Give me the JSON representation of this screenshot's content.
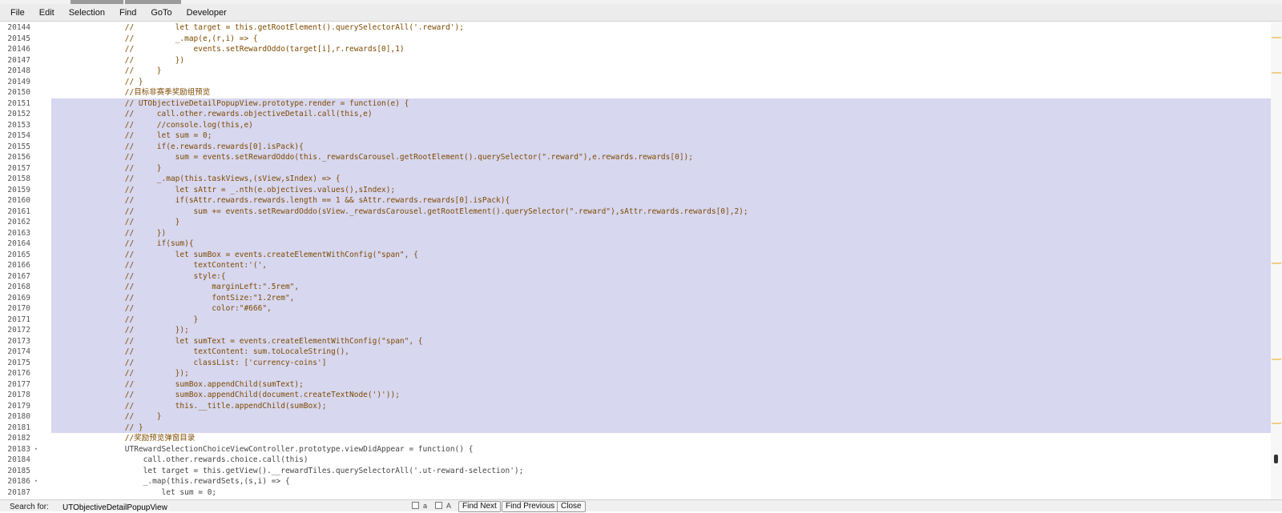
{
  "menu": [
    "File",
    "Edit",
    "Selection",
    "Find",
    "GoTo",
    "Developer"
  ],
  "colors": {
    "selection": "#d7d7f0",
    "comment": "#7d4a00",
    "line_number": "#555555",
    "scroll_marker": "#f1cf86"
  },
  "lines": [
    {
      "n": "20144",
      "code": "        //         let target = this.getRootElement().querySelectorAll('.reward');",
      "comment": true,
      "selected": false,
      "fold": false
    },
    {
      "n": "20145",
      "code": "        //         _.map(e,(r,i) => {",
      "comment": true,
      "selected": false,
      "fold": false
    },
    {
      "n": "20146",
      "code": "        //             events.setRewardOddo(target[i],r.rewards[0],1)",
      "comment": true,
      "selected": false,
      "fold": false
    },
    {
      "n": "20147",
      "code": "        //         })",
      "comment": true,
      "selected": false,
      "fold": false
    },
    {
      "n": "20148",
      "code": "        //     }",
      "comment": true,
      "selected": false,
      "fold": false
    },
    {
      "n": "20149",
      "code": "        // }",
      "comment": true,
      "selected": false,
      "fold": false
    },
    {
      "n": "20150",
      "code": "        //目标非赛季奖励组预览",
      "comment": true,
      "selected": false,
      "fold": false
    },
    {
      "n": "20151",
      "code": "        // UTObjectiveDetailPopupView.prototype.render = function(e) {",
      "comment": true,
      "selected": true,
      "fold": false
    },
    {
      "n": "20152",
      "code": "        //     call.other.rewards.objectiveDetail.call(this,e)",
      "comment": true,
      "selected": true,
      "fold": false
    },
    {
      "n": "20153",
      "code": "        //     //console.log(this,e)",
      "comment": true,
      "selected": true,
      "fold": false
    },
    {
      "n": "20154",
      "code": "        //     let sum = 0;",
      "comment": true,
      "selected": true,
      "fold": false
    },
    {
      "n": "20155",
      "code": "        //     if(e.rewards.rewards[0].isPack){",
      "comment": true,
      "selected": true,
      "fold": false
    },
    {
      "n": "20156",
      "code": "        //         sum = events.setRewardOddo(this._rewardsCarousel.getRootElement().querySelector(\".reward\"),e.rewards.rewards[0]);",
      "comment": true,
      "selected": true,
      "fold": false
    },
    {
      "n": "20157",
      "code": "        //     }",
      "comment": true,
      "selected": true,
      "fold": false
    },
    {
      "n": "20158",
      "code": "        //     _.map(this.taskViews,(sView,sIndex) => {",
      "comment": true,
      "selected": true,
      "fold": false
    },
    {
      "n": "20159",
      "code": "        //         let sAttr = _.nth(e.objectives.values(),sIndex);",
      "comment": true,
      "selected": true,
      "fold": false
    },
    {
      "n": "20160",
      "code": "        //         if(sAttr.rewards.rewards.length == 1 && sAttr.rewards.rewards[0].isPack){",
      "comment": true,
      "selected": true,
      "fold": false
    },
    {
      "n": "20161",
      "code": "        //             sum += events.setRewardOddo(sView._rewardsCarousel.getRootElement().querySelector(\".reward\"),sAttr.rewards.rewards[0],2);",
      "comment": true,
      "selected": true,
      "fold": false
    },
    {
      "n": "20162",
      "code": "        //         }",
      "comment": true,
      "selected": true,
      "fold": false
    },
    {
      "n": "20163",
      "code": "        //     })",
      "comment": true,
      "selected": true,
      "fold": false
    },
    {
      "n": "20164",
      "code": "        //     if(sum){",
      "comment": true,
      "selected": true,
      "fold": false
    },
    {
      "n": "20165",
      "code": "        //         let sumBox = events.createElementWithConfig(\"span\", {",
      "comment": true,
      "selected": true,
      "fold": false
    },
    {
      "n": "20166",
      "code": "        //             textContent:'(',",
      "comment": true,
      "selected": true,
      "fold": false
    },
    {
      "n": "20167",
      "code": "        //             style:{",
      "comment": true,
      "selected": true,
      "fold": false
    },
    {
      "n": "20168",
      "code": "        //                 marginLeft:\".5rem\",",
      "comment": true,
      "selected": true,
      "fold": false
    },
    {
      "n": "20169",
      "code": "        //                 fontSize:\"1.2rem\",",
      "comment": true,
      "selected": true,
      "fold": false
    },
    {
      "n": "20170",
      "code": "        //                 color:\"#666\",",
      "comment": true,
      "selected": true,
      "fold": false
    },
    {
      "n": "20171",
      "code": "        //             }",
      "comment": true,
      "selected": true,
      "fold": false
    },
    {
      "n": "20172",
      "code": "        //         });",
      "comment": true,
      "selected": true,
      "fold": false
    },
    {
      "n": "20173",
      "code": "        //         let sumText = events.createElementWithConfig(\"span\", {",
      "comment": true,
      "selected": true,
      "fold": false
    },
    {
      "n": "20174",
      "code": "        //             textContent: sum.toLocaleString(),",
      "comment": true,
      "selected": true,
      "fold": false
    },
    {
      "n": "20175",
      "code": "        //             classList: ['currency-coins']",
      "comment": true,
      "selected": true,
      "fold": false
    },
    {
      "n": "20176",
      "code": "        //         });",
      "comment": true,
      "selected": true,
      "fold": false
    },
    {
      "n": "20177",
      "code": "        //         sumBox.appendChild(sumText);",
      "comment": true,
      "selected": true,
      "fold": false
    },
    {
      "n": "20178",
      "code": "        //         sumBox.appendChild(document.createTextNode(')'));",
      "comment": true,
      "selected": true,
      "fold": false
    },
    {
      "n": "20179",
      "code": "        //         this.__title.appendChild(sumBox);",
      "comment": true,
      "selected": true,
      "fold": false
    },
    {
      "n": "20180",
      "code": "        //     }",
      "comment": true,
      "selected": true,
      "fold": false
    },
    {
      "n": "20181",
      "code": "        // }",
      "comment": true,
      "selected": true,
      "fold": false
    },
    {
      "n": "20182",
      "code": "        //奖励预览弹窗目录",
      "comment": true,
      "selected": false,
      "fold": false
    },
    {
      "n": "20183",
      "code": "        UTRewardSelectionChoiceViewController.prototype.viewDidAppear = function() {",
      "comment": false,
      "selected": false,
      "fold": true
    },
    {
      "n": "20184",
      "code": "            call.other.rewards.choice.call(this)",
      "comment": false,
      "selected": false,
      "fold": false
    },
    {
      "n": "20185",
      "code": "            let target = this.getView().__rewardTiles.querySelectorAll('.ut-reward-selection');",
      "comment": false,
      "selected": false,
      "fold": false
    },
    {
      "n": "20186",
      "code": "            _.map(this.rewardSets,(s,i) => {",
      "comment": false,
      "selected": false,
      "fold": true
    },
    {
      "n": "20187",
      "code": "                let sum = 0;",
      "comment": false,
      "selected": false,
      "fold": false
    }
  ],
  "findbar": {
    "label": "Search for:",
    "value": "UTObjectiveDetailPopupView",
    "option1": "a",
    "option2": "A",
    "find_next": "Find Next",
    "find_previous": "Find Previous",
    "close": "Close"
  }
}
